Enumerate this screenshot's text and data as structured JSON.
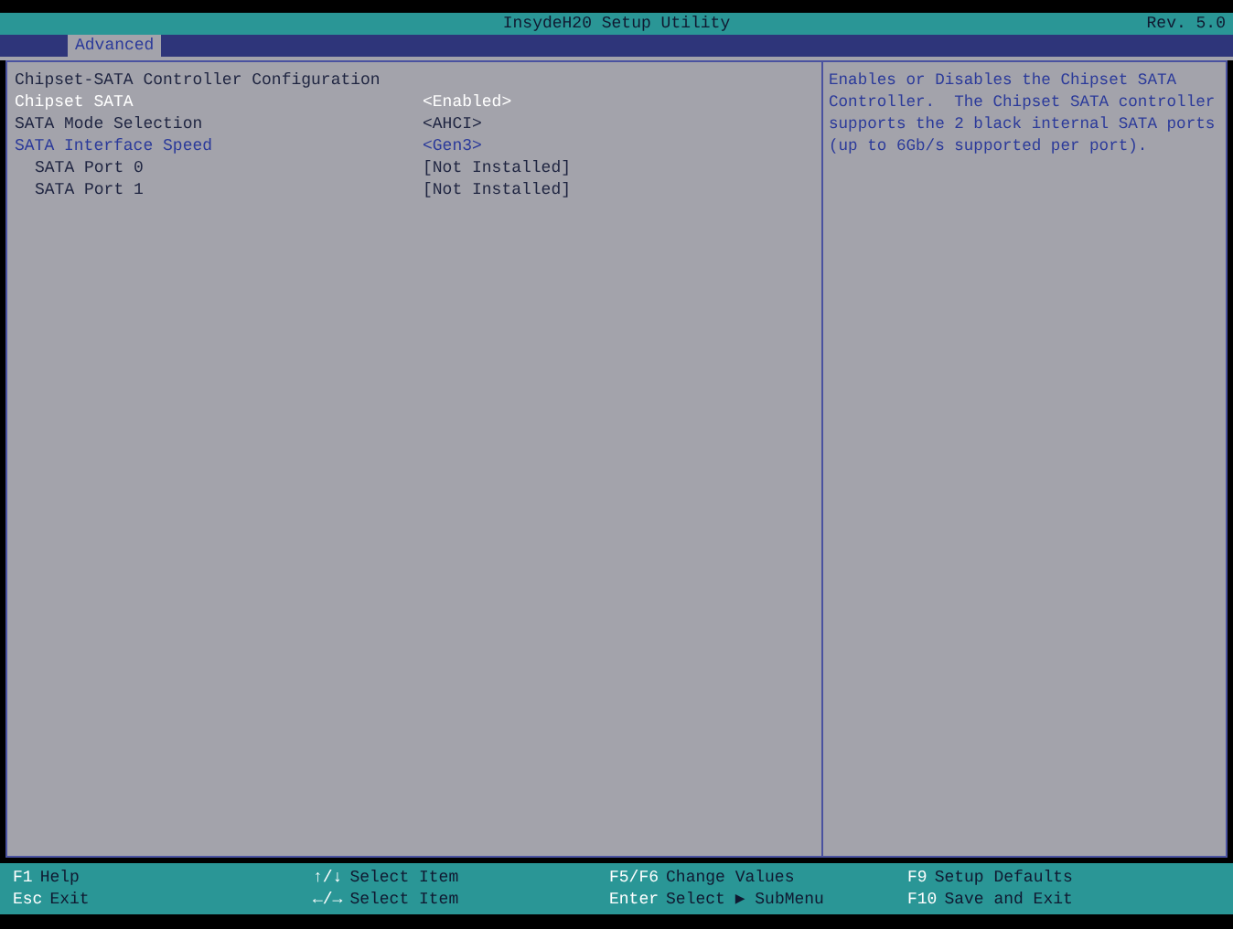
{
  "window": {
    "title": "InsydeH20 Setup Utility",
    "revision": "Rev. 5.0"
  },
  "tabs": [
    {
      "label": "Advanced",
      "selected": true
    }
  ],
  "section_title": "Chipset-SATA Controller Configuration",
  "items": [
    {
      "label": "Chipset SATA",
      "value": "<Enabled>",
      "kind": "option",
      "selected": true,
      "disabled": false
    },
    {
      "label": "SATA Mode Selection",
      "value": "<AHCI>",
      "kind": "option",
      "selected": false,
      "disabled": true
    },
    {
      "label": "SATA Interface Speed",
      "value": "<Gen3>",
      "kind": "option",
      "selected": false,
      "disabled": false
    },
    {
      "label": "SATA Port 0",
      "value": "[Not Installed]",
      "kind": "info",
      "selected": false,
      "disabled": true
    },
    {
      "label": "SATA Port 1",
      "value": "[Not Installed]",
      "kind": "info",
      "selected": false,
      "disabled": true
    }
  ],
  "help_text": "Enables or Disables the Chipset SATA Controller.  The Chipset SATA controller supports the 2 black internal SATA ports (up to 6Gb/s supported per port).",
  "key_legend": [
    [
      {
        "key": "F1",
        "action": "Help"
      },
      {
        "key": "Esc",
        "action": "Exit"
      }
    ],
    [
      {
        "key": "↑/↓",
        "action": "Select Item"
      },
      {
        "key": "←/→",
        "action": "Select Item"
      }
    ],
    [
      {
        "key": "F5/F6",
        "action": "Change Values"
      },
      {
        "key": "Enter",
        "action": "Select ▶ SubMenu"
      }
    ],
    [
      {
        "key": "F9",
        "action": "Setup Defaults"
      },
      {
        "key": "F10",
        "action": "Save and Exit"
      }
    ]
  ]
}
